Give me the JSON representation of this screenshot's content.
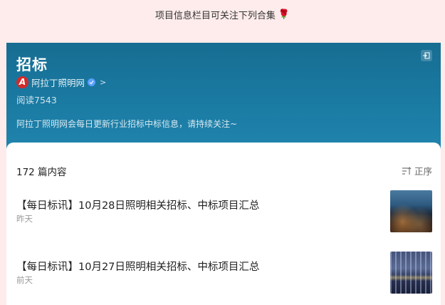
{
  "top_note": {
    "text": "项目信息栏目可关注下列合集",
    "flower_icon": "rose-icon"
  },
  "header": {
    "title": "招标",
    "account_name": "阿拉丁照明网",
    "logo_letter": "A",
    "reads": "阅读7543",
    "description": "阿拉丁照明网会每日更新行业招标中标信息，请持续关注~",
    "colors": {
      "top": "#176d92",
      "bottom": "#2084ad",
      "logo": "#d42a2a"
    }
  },
  "list": {
    "count_label": "172 篇内容",
    "sort_label": "正序",
    "articles": [
      {
        "title": "【每日标讯】10月28日照明相关招标、中标项目汇总",
        "date": "昨天"
      },
      {
        "title": "【每日标讯】10月27日照明相关招标、中标项目汇总",
        "date": "前天"
      }
    ]
  }
}
